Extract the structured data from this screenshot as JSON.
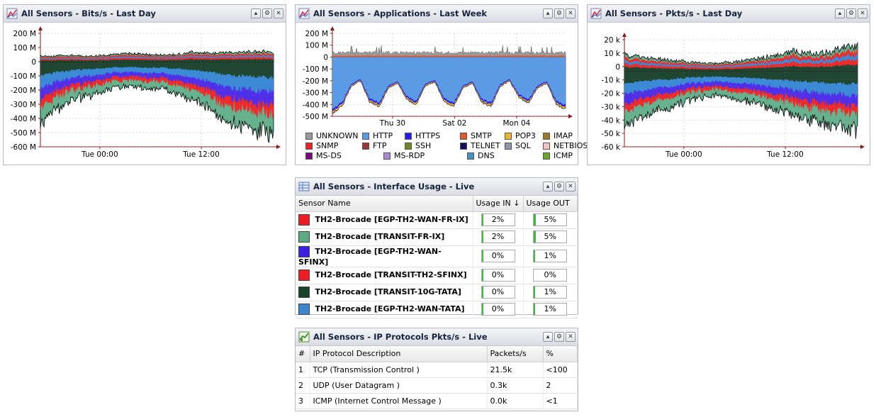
{
  "panels": {
    "bits": {
      "title": "All Sensors - Bits/s - Last Day"
    },
    "apps": {
      "title": "All Sensors - Applications - Last Week"
    },
    "pkts": {
      "title": "All Sensors - Pkts/s - Last Day"
    },
    "iface": {
      "title": "All Sensors - Interface Usage - Live"
    },
    "ipproto": {
      "title": "All Sensors - IP Protocols Pkts/s - Live"
    }
  },
  "tool_icons": [
    "minimize-icon",
    "settings-icon",
    "close-icon"
  ],
  "chart_data": [
    {
      "type": "area",
      "title": "All Sensors - Bits/s - Last Day",
      "yticks": [
        "200 M",
        "100 M",
        "0",
        "-100 M",
        "-200 M",
        "-300 M",
        "-400 M",
        "-500 M",
        "-600 M"
      ],
      "ylim": [
        -600,
        200
      ],
      "xticks": [
        "Tue 00:00",
        "Tue 12:00"
      ],
      "grid": true,
      "background": "#1e4630",
      "series_colors": [
        "#1e4630",
        "#3c8ad6",
        "#4f30e8",
        "#ee2a2a",
        "#66b28f"
      ],
      "in_envelope": [
        40,
        38,
        42,
        44,
        46,
        40,
        38,
        42,
        48,
        52,
        60,
        58,
        54,
        50,
        48,
        46,
        50,
        54,
        70,
        64,
        62,
        60,
        62,
        66,
        64,
        70,
        74,
        72,
        60
      ],
      "out_envelope": [
        -440,
        -380,
        -330,
        -300,
        -270,
        -250,
        -235,
        -215,
        -200,
        -185,
        -175,
        -170,
        -175,
        -185,
        -190,
        -200,
        -215,
        -235,
        -260,
        -290,
        -330,
        -370,
        -410,
        -430,
        -460,
        -470,
        -480,
        -490,
        -510
      ]
    },
    {
      "type": "area",
      "title": "All Sensors - Applications - Last Week",
      "yticks": [
        "200 M",
        "100 M",
        "0",
        "-100 M",
        "-200 M",
        "-300 M",
        "-400 M",
        "-500 M"
      ],
      "ylim": [
        -500,
        200
      ],
      "xticks": [
        "Thu 30",
        "Sat 02",
        "Mon 04"
      ],
      "grid": true,
      "dominant_series": "HTTP",
      "legend": [
        "UNKNOWN",
        "HTTP",
        "HTTPS",
        "SMTP",
        "POP3",
        "IMAP",
        "SNMP",
        "FTP",
        "SSH",
        "TELNET",
        "SQL",
        "NETBIOS",
        "MS-DS",
        "MS-RDP",
        "DNS",
        "ICMP"
      ],
      "legend_colors": [
        "#999999",
        "#5b9be6",
        "#2a1ef0",
        "#e8572b",
        "#f2b532",
        "#a0782e",
        "#ee2222",
        "#9b3434",
        "#6e8a1e",
        "#101060",
        "#8f98a8",
        "#f4c4c4",
        "#7a0a7a",
        "#a989d0",
        "#4a90bb",
        "#6ea62a"
      ],
      "days_envelope": [
        -470,
        -420,
        -250,
        -200,
        -380,
        -420,
        -260,
        -220,
        -360,
        -400,
        -240,
        -210,
        -380,
        -420,
        -260,
        -220,
        -380,
        -420,
        -250,
        -200,
        -340,
        -390,
        -260,
        -220,
        -400,
        -440
      ]
    },
    {
      "type": "area",
      "title": "All Sensors - Pkts/s - Last Day",
      "yticks": [
        "20 k",
        "10 k",
        "0",
        "-10 k",
        "-20 k",
        "-30 k",
        "-40 k",
        "-50 k",
        "-60 k"
      ],
      "ylim": [
        -60,
        25
      ],
      "xticks": [
        "Tue 00:00",
        "Tue 12:00"
      ],
      "grid": true,
      "series_colors": [
        "#1e4630",
        "#3c8ad6",
        "#4f30e8",
        "#ee2a2a",
        "#66b28f"
      ],
      "in_envelope": [
        13,
        12,
        11,
        10,
        10,
        9,
        8,
        8,
        7,
        7,
        6,
        6,
        7,
        7,
        8,
        9,
        10,
        11,
        12,
        14,
        16,
        15,
        14,
        14,
        15,
        16,
        18,
        19,
        20
      ],
      "out_envelope": [
        -45,
        -40,
        -36,
        -33,
        -31,
        -29,
        -27,
        -25,
        -23,
        -21,
        -20,
        -19,
        -20,
        -21,
        -22,
        -24,
        -26,
        -28,
        -30,
        -32,
        -34,
        -36,
        -38,
        -40,
        -42,
        -43,
        -44,
        -45,
        -47
      ]
    }
  ],
  "interface_usage": {
    "columns": [
      "Sensor Name",
      "Usage IN ↓",
      "Usage OUT"
    ],
    "rows": [
      {
        "color": "#ee1c24",
        "name": "TH2-Brocade [EGP-TH2-WAN-FR-IX]",
        "in": "2%",
        "in_pct": 2,
        "out": "5%",
        "out_pct": 5
      },
      {
        "color": "#5aab84",
        "name": "TH2-Brocade [TRANSIT-FR-IX]",
        "in": "2%",
        "in_pct": 2,
        "out": "5%",
        "out_pct": 5
      },
      {
        "color": "#3b20e2",
        "name": "TH2-Brocade [EGP-TH2-WAN-SFINX]",
        "in": "0%",
        "in_pct": 0,
        "out": "1%",
        "out_pct": 1
      },
      {
        "color": "#ee1c24",
        "name": "TH2-Brocade [TRANSIT-TH2-SFINX]",
        "in": "0%",
        "in_pct": 0,
        "out": "0%",
        "out_pct": 0
      },
      {
        "color": "#1a4226",
        "name": "TH2-Brocade [TRANSIT-10G-TATA]",
        "in": "0%",
        "in_pct": 0,
        "out": "1%",
        "out_pct": 1
      },
      {
        "color": "#3d86cc",
        "name": "TH2-Brocade [EGP-TH2-WAN-TATA]",
        "in": "0%",
        "in_pct": 0,
        "out": "1%",
        "out_pct": 1
      }
    ]
  },
  "ip_protocols": {
    "columns": [
      "#",
      "IP Protocol Description",
      "Packets/s",
      "%"
    ],
    "rows": [
      {
        "n": "1",
        "desc": "TCP (Transmission Control )",
        "pkts": "21.5k",
        "pct": "<100"
      },
      {
        "n": "2",
        "desc": "UDP (User Datagram )",
        "pkts": "0.3k",
        "pct": "2"
      },
      {
        "n": "3",
        "desc": "ICMP (Internet Control Message )",
        "pkts": "0.0k",
        "pct": "<1"
      }
    ]
  }
}
